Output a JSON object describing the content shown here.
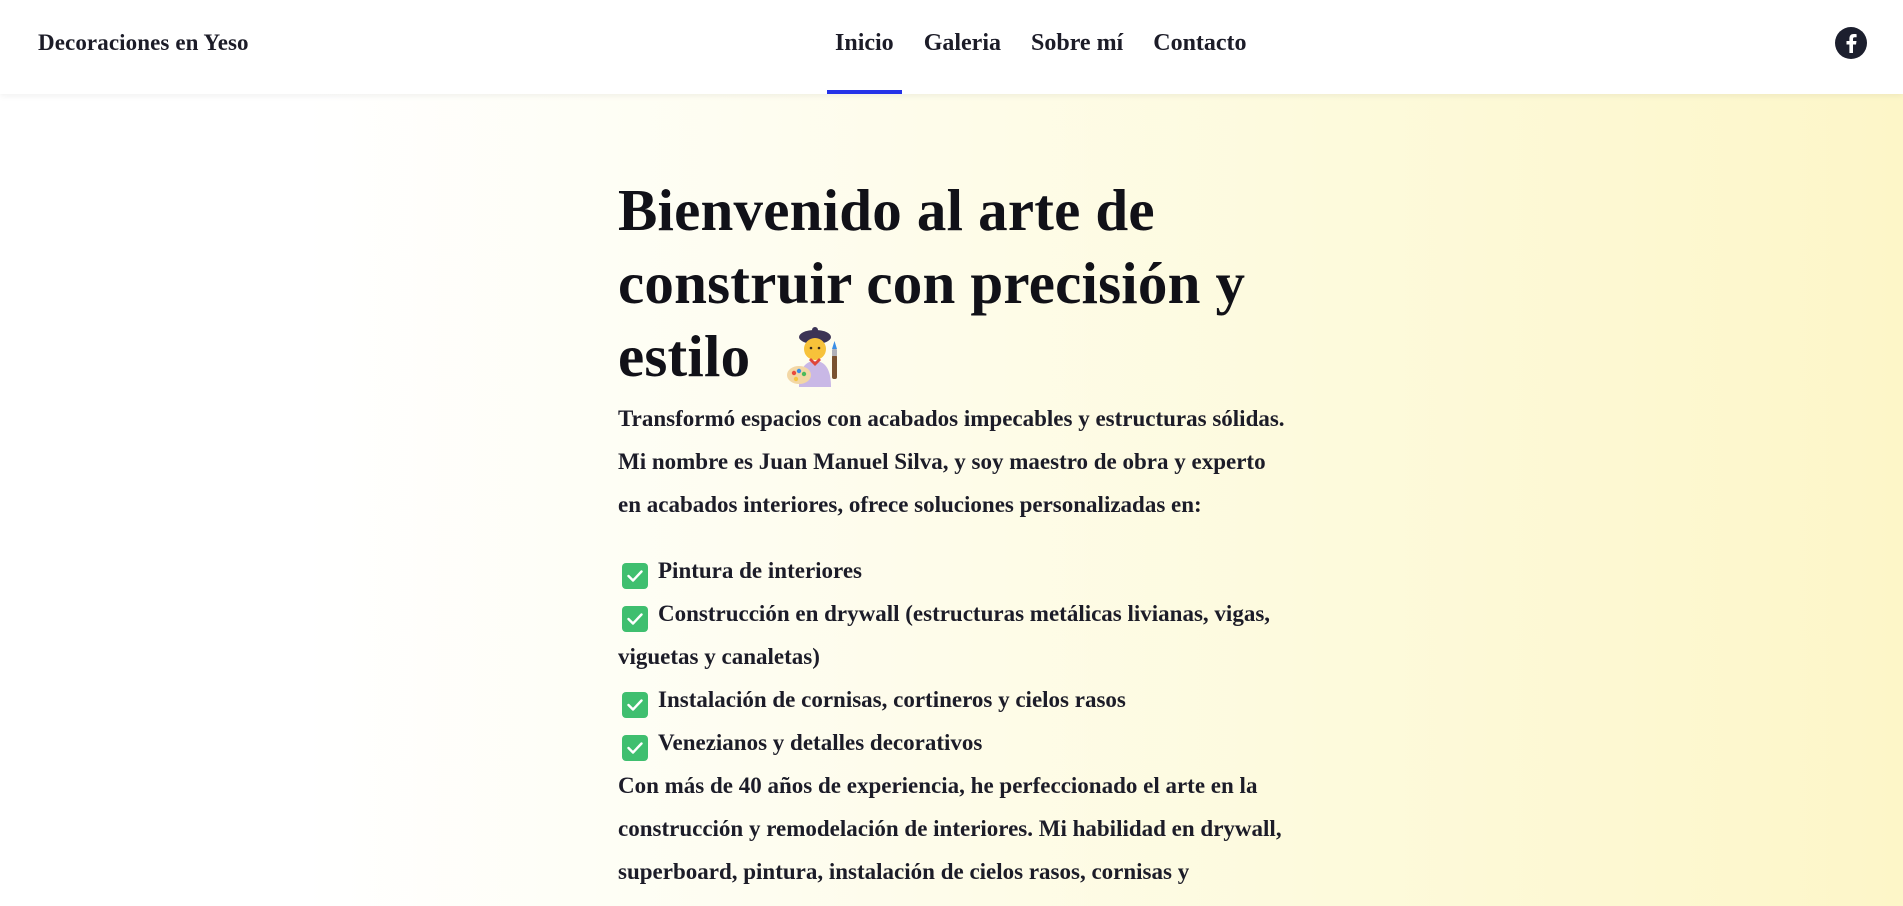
{
  "nav": {
    "brand": "Decoraciones en Yeso",
    "links": [
      {
        "label": "Inicio",
        "active": true
      },
      {
        "label": "Galeria",
        "active": false
      },
      {
        "label": "Sobre mí",
        "active": false
      },
      {
        "label": "Contacto",
        "active": false
      }
    ],
    "social_icon": "facebook-icon"
  },
  "hero": {
    "headline_line1": "Bienvenido al arte de",
    "headline_line2": "construir con precisión y",
    "headline_line3": "estilo",
    "headline_emoji": "artist-emoji",
    "intro_line1": "Transformó espacios con acabados impecables y estructuras sólidas.",
    "intro_line2": "Mi nombre es Juan Manuel Silva, y soy maestro de obra y experto",
    "intro_line3": "en acabados interiores, ofrece soluciones personalizadas en:",
    "services": [
      {
        "line1": "Pintura de interiores",
        "line2": ""
      },
      {
        "line1": "Construcción en drywall (estructuras metálicas livianas, vigas,",
        "line2": "viguetas y canaletas)"
      },
      {
        "line1": "Instalación de cornisas, cortineros y cielos rasos",
        "line2": ""
      },
      {
        "line1": "Venezianos y detalles decorativos",
        "line2": ""
      }
    ],
    "experience_line1": "Con más de 40 años de experiencia, he perfeccionado el arte en la",
    "experience_line2": "construcción y remodelación de interiores. Mi habilidad en drywall,",
    "experience_line3": "superboard, pintura, instalación de cielos rasos, cornisas y"
  },
  "colors": {
    "accent": "#2432e8",
    "check_green": "#3fbf6f",
    "text": "#1c1c28"
  }
}
